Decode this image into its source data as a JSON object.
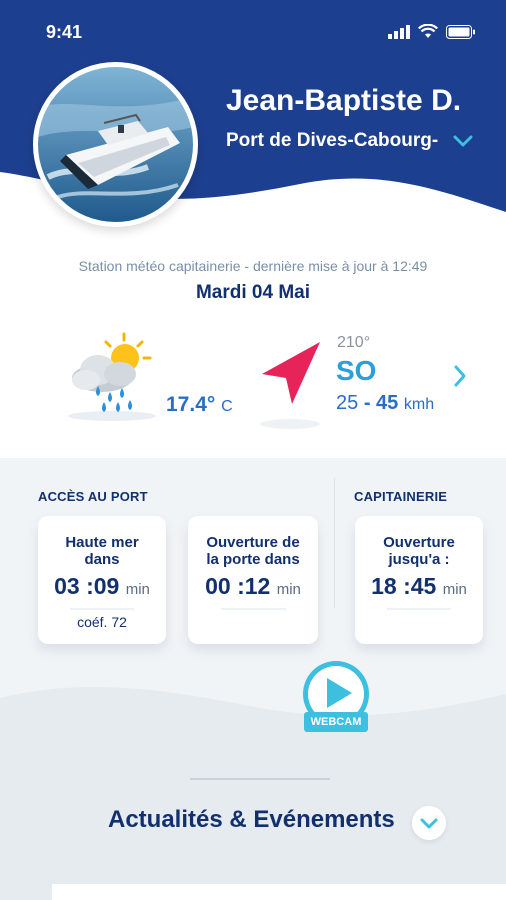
{
  "status_bar": {
    "time": "9:41"
  },
  "profile": {
    "name": "Jean-Baptiste D.",
    "port": "Port de Dives-Cabourg-"
  },
  "weather": {
    "station_label": "Station météo capitainerie - dernière mise à jour à 12:49",
    "date": "Mardi 04 Mai",
    "temperature": "17.4°",
    "temperature_unit": "C",
    "wind_degrees": "210°",
    "wind_direction": "SO",
    "wind_min": "25",
    "wind_sep": "-",
    "wind_max": "45",
    "wind_unit": "kmh"
  },
  "port_access": {
    "label": "ACCÈS AU PORT",
    "cards": [
      {
        "title_line1": "Haute mer",
        "title_line2": "dans",
        "hours": "03",
        "minutes": "09",
        "unit": "min",
        "coef": "coéf. 72"
      },
      {
        "title_line1": "Ouverture de",
        "title_line2": "la porte dans",
        "hours": "00",
        "minutes": "12",
        "unit": "min"
      }
    ]
  },
  "capitainerie": {
    "label": "CAPITAINERIE",
    "card": {
      "title_line1": "Ouverture",
      "title_line2": "jusqu'a :",
      "hours": "18",
      "minutes": "45",
      "unit": "min"
    }
  },
  "webcam": {
    "label": "WEBCAM"
  },
  "news": {
    "title": "Actualités & Evénements"
  },
  "colors": {
    "header_blue": "#1d3f8f",
    "navy_text": "#12306e",
    "accent_cyan": "#3dbfe0",
    "arrow_red": "#e6245a"
  }
}
